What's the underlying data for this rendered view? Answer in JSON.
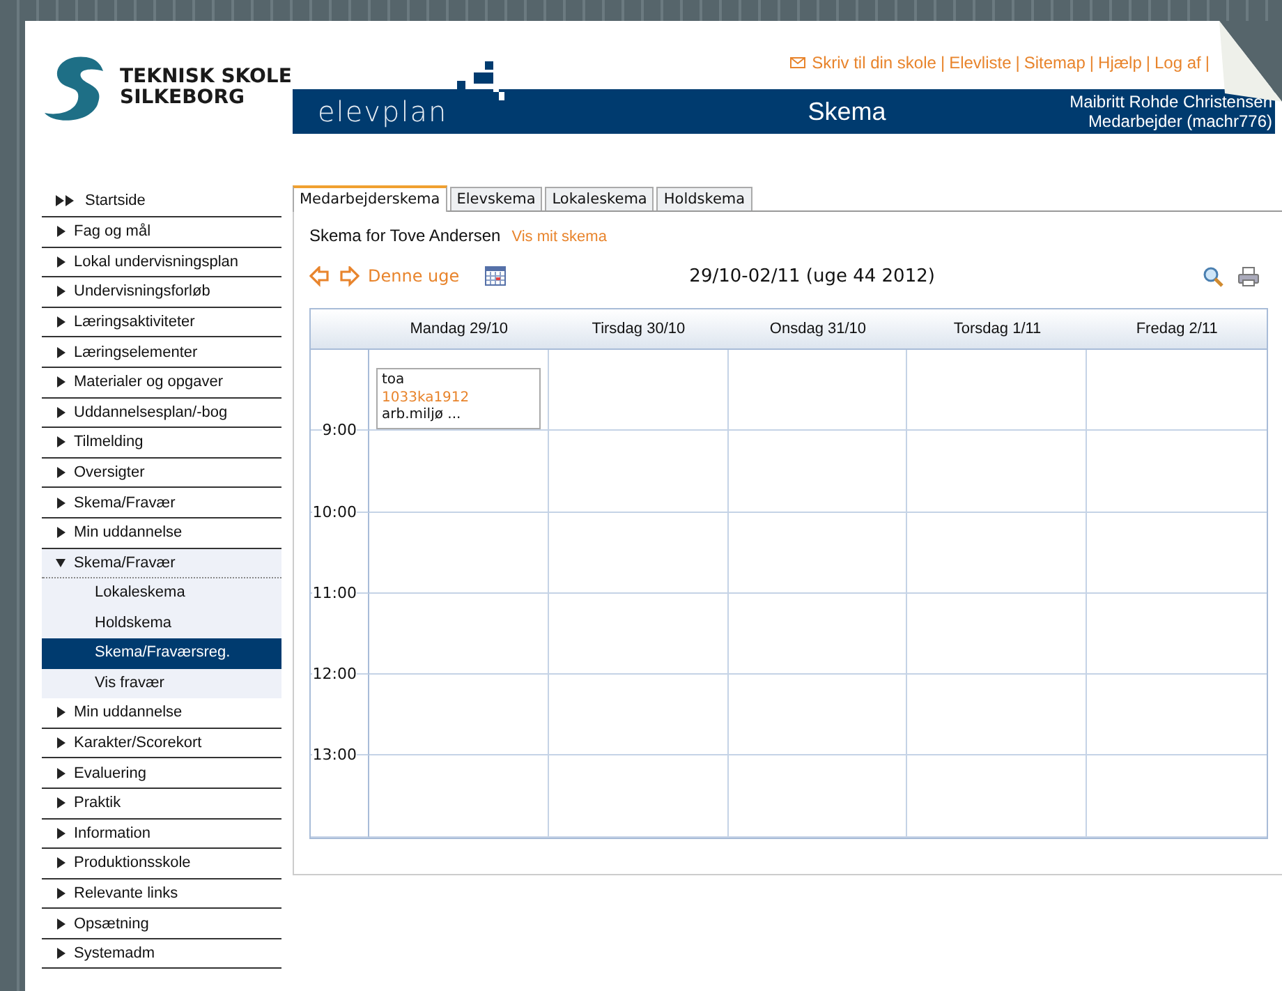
{
  "header": {
    "school_name": [
      "TEKNISK SKOLE",
      "SILKEBORG"
    ],
    "top_links": [
      {
        "label": "Skriv til din skole",
        "kind": "mail",
        "separator": "|"
      },
      {
        "label": "Elevliste",
        "separator": "|"
      },
      {
        "label": "Sitemap",
        "separator": "|"
      },
      {
        "label": "Hjælp",
        "separator": "|"
      },
      {
        "label": "Log af",
        "separator": "|"
      }
    ],
    "brand": "elevplan",
    "title": "Skema",
    "user_name": "Maibritt Rohde Christensen",
    "user_role": "Medarbejder (machr776)"
  },
  "sidebar": {
    "items": [
      {
        "label": "Startside",
        "kind": "home"
      },
      {
        "label": "Fag og mål",
        "kind": "section",
        "expanded": false
      },
      {
        "label": "Lokal undervisningsplan",
        "kind": "section",
        "expanded": false
      },
      {
        "label": "Undervisningsforløb",
        "kind": "section",
        "expanded": false
      },
      {
        "label": "Læringsaktiviteter",
        "kind": "section",
        "expanded": false
      },
      {
        "label": "Læringselementer",
        "kind": "section",
        "expanded": false
      },
      {
        "label": "Materialer og opgaver",
        "kind": "section",
        "expanded": false
      },
      {
        "label": "Uddannelsesplan/-bog",
        "kind": "section",
        "expanded": false
      },
      {
        "label": "Tilmelding",
        "kind": "section",
        "expanded": false
      },
      {
        "label": "Oversigter",
        "kind": "section",
        "expanded": false
      },
      {
        "label": "Skema/Fravær",
        "kind": "section",
        "expanded": false
      },
      {
        "label": "Min uddannelse",
        "kind": "section",
        "expanded": false
      },
      {
        "label": "Skema/Fravær",
        "kind": "section",
        "expanded": true,
        "children": [
          {
            "label": "Lokaleskema",
            "selected": false
          },
          {
            "label": "Holdskema",
            "selected": false
          },
          {
            "label": "Skema/Fraværsreg.",
            "selected": true
          },
          {
            "label": "Vis fravær",
            "selected": false
          }
        ]
      },
      {
        "label": "Min uddannelse",
        "kind": "section",
        "expanded": false
      },
      {
        "label": "Karakter/Scorekort",
        "kind": "section",
        "expanded": false
      },
      {
        "label": "Evaluering",
        "kind": "section",
        "expanded": false
      },
      {
        "label": "Praktik",
        "kind": "section",
        "expanded": false
      },
      {
        "label": "Information",
        "kind": "section",
        "expanded": false
      },
      {
        "label": "Produktionsskole",
        "kind": "section",
        "expanded": false
      },
      {
        "label": "Relevante links",
        "kind": "section",
        "expanded": false
      },
      {
        "label": "Opsætning",
        "kind": "section",
        "expanded": false
      },
      {
        "label": "Systemadm",
        "kind": "section",
        "expanded": false
      }
    ]
  },
  "tabs": [
    {
      "label": "Medarbejderskema",
      "selected": true
    },
    {
      "label": "Elevskema",
      "selected": false
    },
    {
      "label": "Lokaleskema",
      "selected": false
    },
    {
      "label": "Holdskema",
      "selected": false
    }
  ],
  "schedule": {
    "heading": "Skema for Tove Andersen",
    "own_link": "Vis mit skema",
    "this_week": "Denne uge",
    "range": "29/10-02/11 (uge 44 2012)",
    "days": [
      "Mandag 29/10",
      "Tirsdag 30/10",
      "Onsdag 31/10",
      "Torsdag 1/11",
      "Fredag 2/11"
    ],
    "rows": [
      {
        "time": "9:00",
        "cells": [
          {
            "kind": "event",
            "title": "toa",
            "code": "1033ka1912",
            "text": "arb.miljø ..."
          },
          {
            "kind": "empty"
          },
          {
            "kind": "empty"
          },
          {
            "kind": "empty"
          },
          {
            "kind": "empty"
          }
        ]
      },
      {
        "time": "10:00",
        "cells": [
          {
            "kind": "empty"
          },
          {
            "kind": "empty"
          },
          {
            "kind": "empty"
          },
          {
            "kind": "empty"
          },
          {
            "kind": "empty"
          }
        ]
      },
      {
        "time": "11:00",
        "cells": [
          {
            "kind": "empty"
          },
          {
            "kind": "empty"
          },
          {
            "kind": "empty"
          },
          {
            "kind": "empty"
          },
          {
            "kind": "empty"
          }
        ]
      },
      {
        "time": "12:00",
        "cells": [
          {
            "kind": "empty"
          },
          {
            "kind": "empty"
          },
          {
            "kind": "empty"
          },
          {
            "kind": "empty"
          },
          {
            "kind": "empty"
          }
        ]
      },
      {
        "time": "13:00",
        "cells": [
          {
            "kind": "empty"
          },
          {
            "kind": "empty"
          },
          {
            "kind": "empty"
          },
          {
            "kind": "empty"
          },
          {
            "kind": "empty"
          }
        ]
      },
      {
        "cells": [
          {
            "kind": "empty"
          },
          {
            "kind": "empty"
          },
          {
            "kind": "empty"
          },
          {
            "kind": "empty"
          },
          {
            "kind": "empty"
          }
        ]
      }
    ]
  }
}
